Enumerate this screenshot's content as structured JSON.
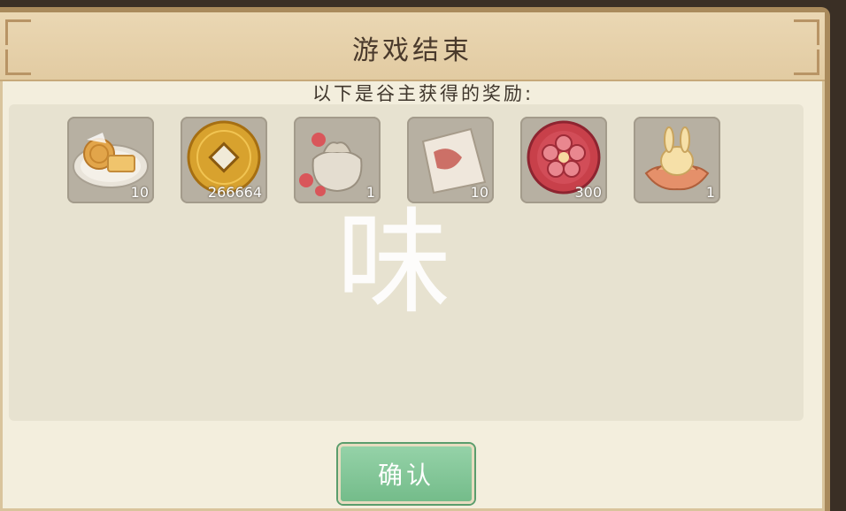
{
  "dialog": {
    "title": "游戏结束",
    "subtitle": "以下是谷主获得的奖励:",
    "confirm_label": "确认"
  },
  "rewards": [
    {
      "icon": "mooncake-plate-icon",
      "quantity": "10"
    },
    {
      "icon": "copper-coin-icon",
      "quantity": "266664"
    },
    {
      "icon": "cloth-bag-icon",
      "quantity": "1"
    },
    {
      "icon": "paper-scroll-icon",
      "quantity": "10"
    },
    {
      "icon": "plum-blossom-token-icon",
      "quantity": "300"
    },
    {
      "icon": "lotus-rabbit-icon",
      "quantity": "1"
    }
  ],
  "watermark": "味",
  "colors": {
    "panel": "#f3eedd",
    "header": "#e2cba2",
    "slot": "#b7b0a2",
    "confirm": "#74bc8a"
  }
}
